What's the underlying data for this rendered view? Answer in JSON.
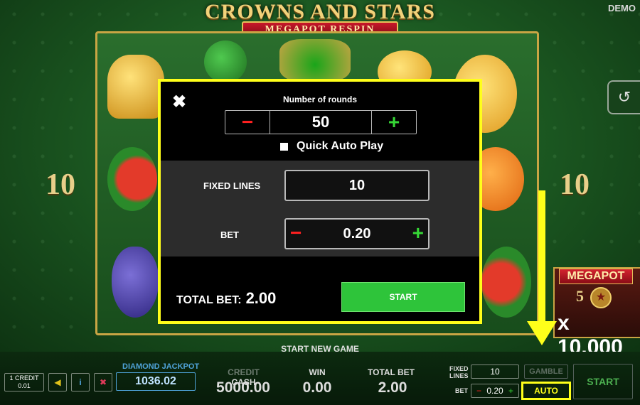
{
  "header": {
    "title": "CROWNS AND STARS",
    "subtitle": "MEGAPOT RESPIN",
    "demo": "DEMO"
  },
  "reels": {
    "left_lines": "10",
    "right_lines": "10"
  },
  "megapot": {
    "title": "MEGAPOT",
    "count": "5",
    "multiplier": "x 10.000"
  },
  "dialog": {
    "rounds_label": "Number of rounds",
    "rounds_value": "50",
    "quick_auto_play": "Quick Auto Play",
    "fixed_lines_label": "FIXED LINES",
    "fixed_lines_value": "10",
    "bet_label": "BET",
    "bet_value": "0.20",
    "total_bet_label": "TOTAL BET:",
    "total_bet_value": "2.00",
    "start_label": "START"
  },
  "bottom_bar": {
    "start_new_game": "START NEW GAME",
    "credit_line1": "1 CREDIT",
    "credit_line2": "0.01",
    "diamond_jackpot_label": "DIAMOND JACKPOT",
    "diamond_jackpot_value": "1036.02",
    "credit_prefix": "CREDIT",
    "cash_label": "CASH",
    "cash_value": "5000.00",
    "win_label": "WIN",
    "win_value": "0.00",
    "total_bet_label": "TOTAL BET",
    "total_bet_value": "2.00",
    "fixed_lines_label_1": "FIXED",
    "fixed_lines_label_2": "LINES",
    "fixed_lines_value": "10",
    "bet_label": "BET",
    "bet_value": "0.20",
    "gamble_label": "GAMBLE",
    "auto_label": "AUTO",
    "start_label": "START"
  },
  "colors": {
    "highlight": "#ffff1a",
    "start_green": "#2ec43a",
    "minus_red": "#ff2020",
    "plus_green": "#36d836"
  }
}
